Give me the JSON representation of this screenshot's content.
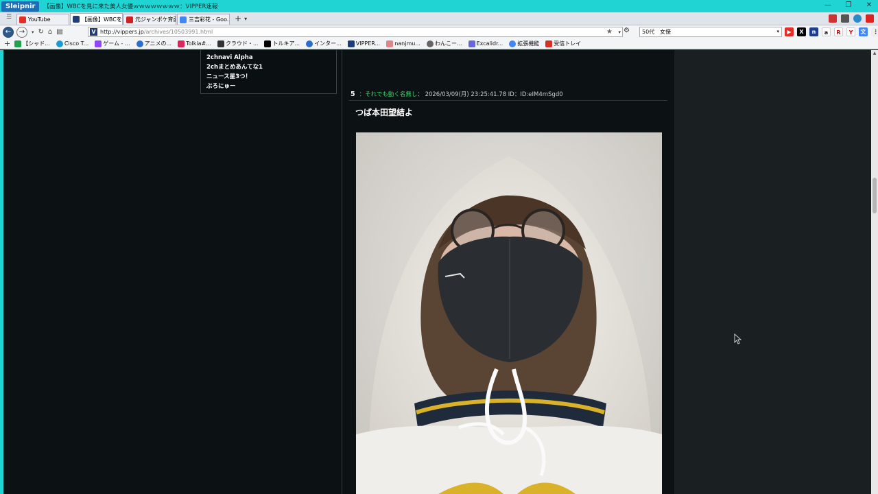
{
  "window": {
    "app_name": "Sleipnir",
    "title": "【画像】WBCを見に来た美人女優ｗｗｗｗｗｗｗｗ：VIPPER速報"
  },
  "tabs": [
    {
      "label": "YouTube",
      "favicon_color": "#e52d27"
    },
    {
      "label": "【画像】WBCを見...",
      "favicon_color": "#1e3c78"
    },
    {
      "label": "元ジャンポケ斉藤...",
      "favicon_color": "#c22"
    },
    {
      "label": "三吉彩花 - Goo...",
      "favicon_color": "#4285f4"
    }
  ],
  "navbar": {
    "url_host": "http://vippers.jp",
    "url_path": "/archives/10503991.html",
    "search_value": "50代　女優"
  },
  "bookmarks": [
    {
      "label": "【シャド...",
      "color": "#1fa24b"
    },
    {
      "label": "Cisco T...",
      "color": "#1b9ad6"
    },
    {
      "label": "ゲーム - ...",
      "color": "#9146ff"
    },
    {
      "label": "アニメの...",
      "color": "#2c6fd1"
    },
    {
      "label": "Tolkia#...",
      "color": "#e0245e"
    },
    {
      "label": "クラウド・...",
      "color": "#333"
    },
    {
      "label": "トルキア...",
      "color": "#000"
    },
    {
      "label": "インター...",
      "color": "#2d6ccf"
    },
    {
      "label": "VIPPER...",
      "color": "#1e3c78"
    },
    {
      "label": "nanjmu...",
      "color": "#d88"
    },
    {
      "label": "わんこー...",
      "color": "#666"
    },
    {
      "label": "Excalidr...",
      "color": "#6965db"
    },
    {
      "label": "拡張機能",
      "color": "#4285f4"
    },
    {
      "label": "受信トレイ",
      "color": "#d93025"
    }
  ],
  "sidebar_links": [
    "2chnavi Alpha",
    "2chまとめあんてな1",
    "ニュース星3つ！",
    "ぶろにゅー"
  ],
  "post": {
    "number": "5",
    "name": "：それでも動く名無し",
    "meta": "： 2026/03/09(月) 23:25:41.78 ID：ID:eIM4mSgd0",
    "body": "つば本田望結よ"
  }
}
